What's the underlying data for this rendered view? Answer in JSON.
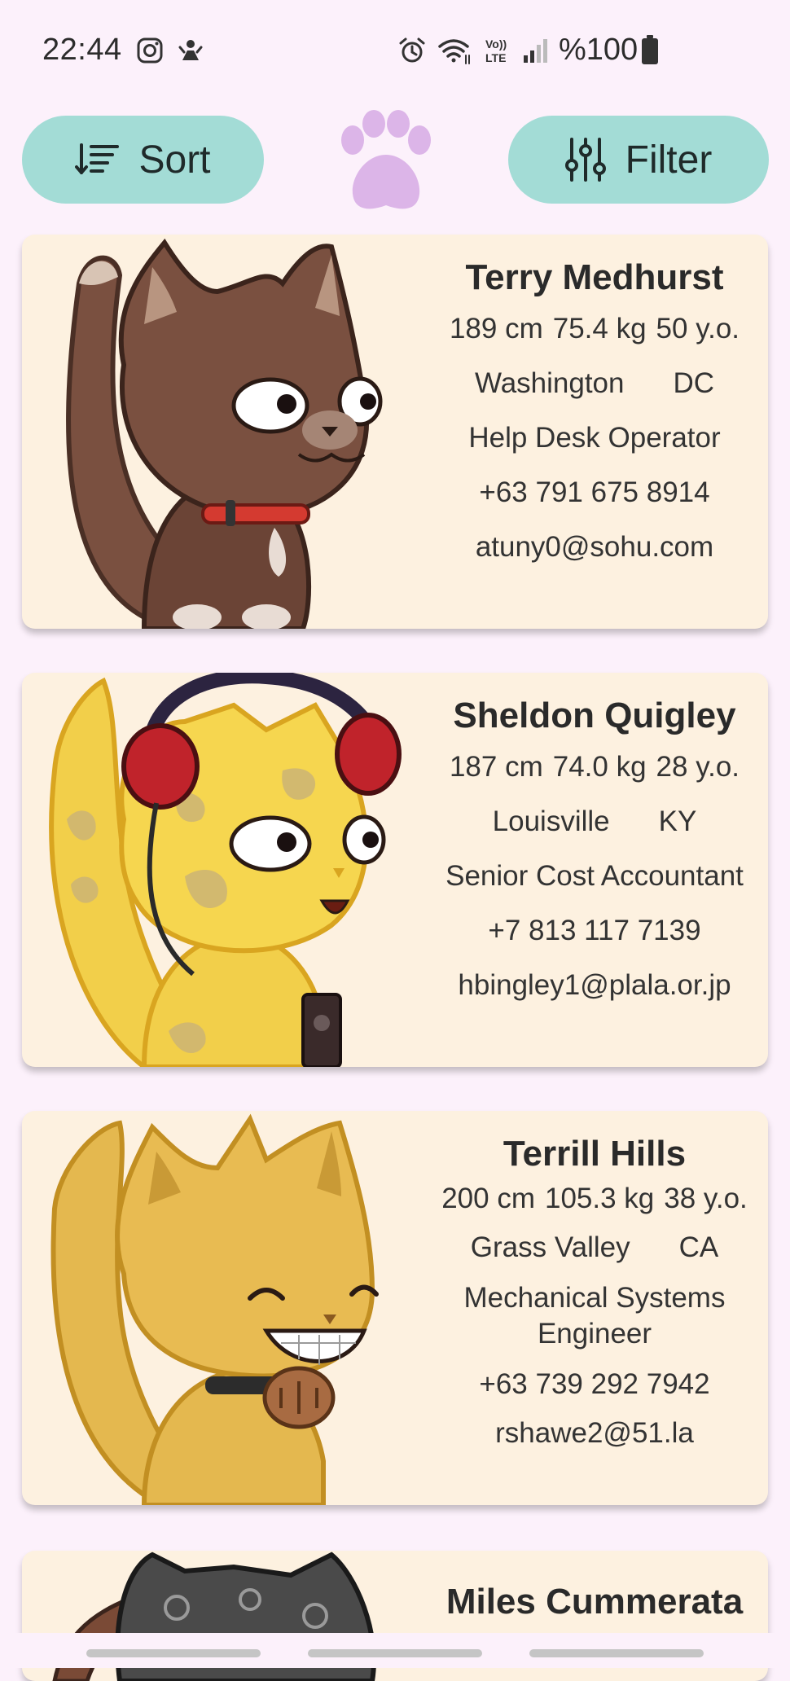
{
  "status_bar": {
    "time": "22:44",
    "battery_text": "%100",
    "icons": [
      "instagram-icon",
      "notification-icon",
      "alarm-icon",
      "wifi-icon",
      "volte-icon",
      "signal-icon",
      "battery-icon"
    ]
  },
  "toolbar": {
    "sort_label": "Sort",
    "filter_label": "Filter",
    "logo": "paw-logo",
    "accent_color": "#a3dcd6",
    "logo_color": "#dcb5e8"
  },
  "cards": [
    {
      "name": "Terry Medhurst",
      "height": "189 cm",
      "weight": "75.4 kg",
      "age": "50 y.o.",
      "city": "Washington",
      "state": "DC",
      "job": "Help Desk Operator",
      "phone": "+63 791 675 8914",
      "email": "atuny0@sohu.com",
      "avatar": "brown-cat-illustration"
    },
    {
      "name": "Sheldon Quigley",
      "height": "187 cm",
      "weight": "74.0 kg",
      "age": "28 y.o.",
      "city": "Louisville",
      "state": "KY",
      "job": "Senior Cost Accountant",
      "phone": "+7 813 117 7139",
      "email": "hbingley1@plala.or.jp",
      "avatar": "yellow-cat-headphones-illustration"
    },
    {
      "name": "Terrill Hills",
      "height": "200 cm",
      "weight": "105.3 kg",
      "age": "38 y.o.",
      "city": "Grass Valley",
      "state": "CA",
      "job": "Mechanical Systems Engineer",
      "phone": "+63 739 292 7942",
      "email": "rshawe2@51.la",
      "avatar": "golden-cat-collar-illustration"
    },
    {
      "name": "Miles Cummerata",
      "avatar": "gray-paisley-cat-illustration"
    }
  ],
  "colors": {
    "background": "#fcf1fb",
    "card": "#fdf1e0"
  }
}
